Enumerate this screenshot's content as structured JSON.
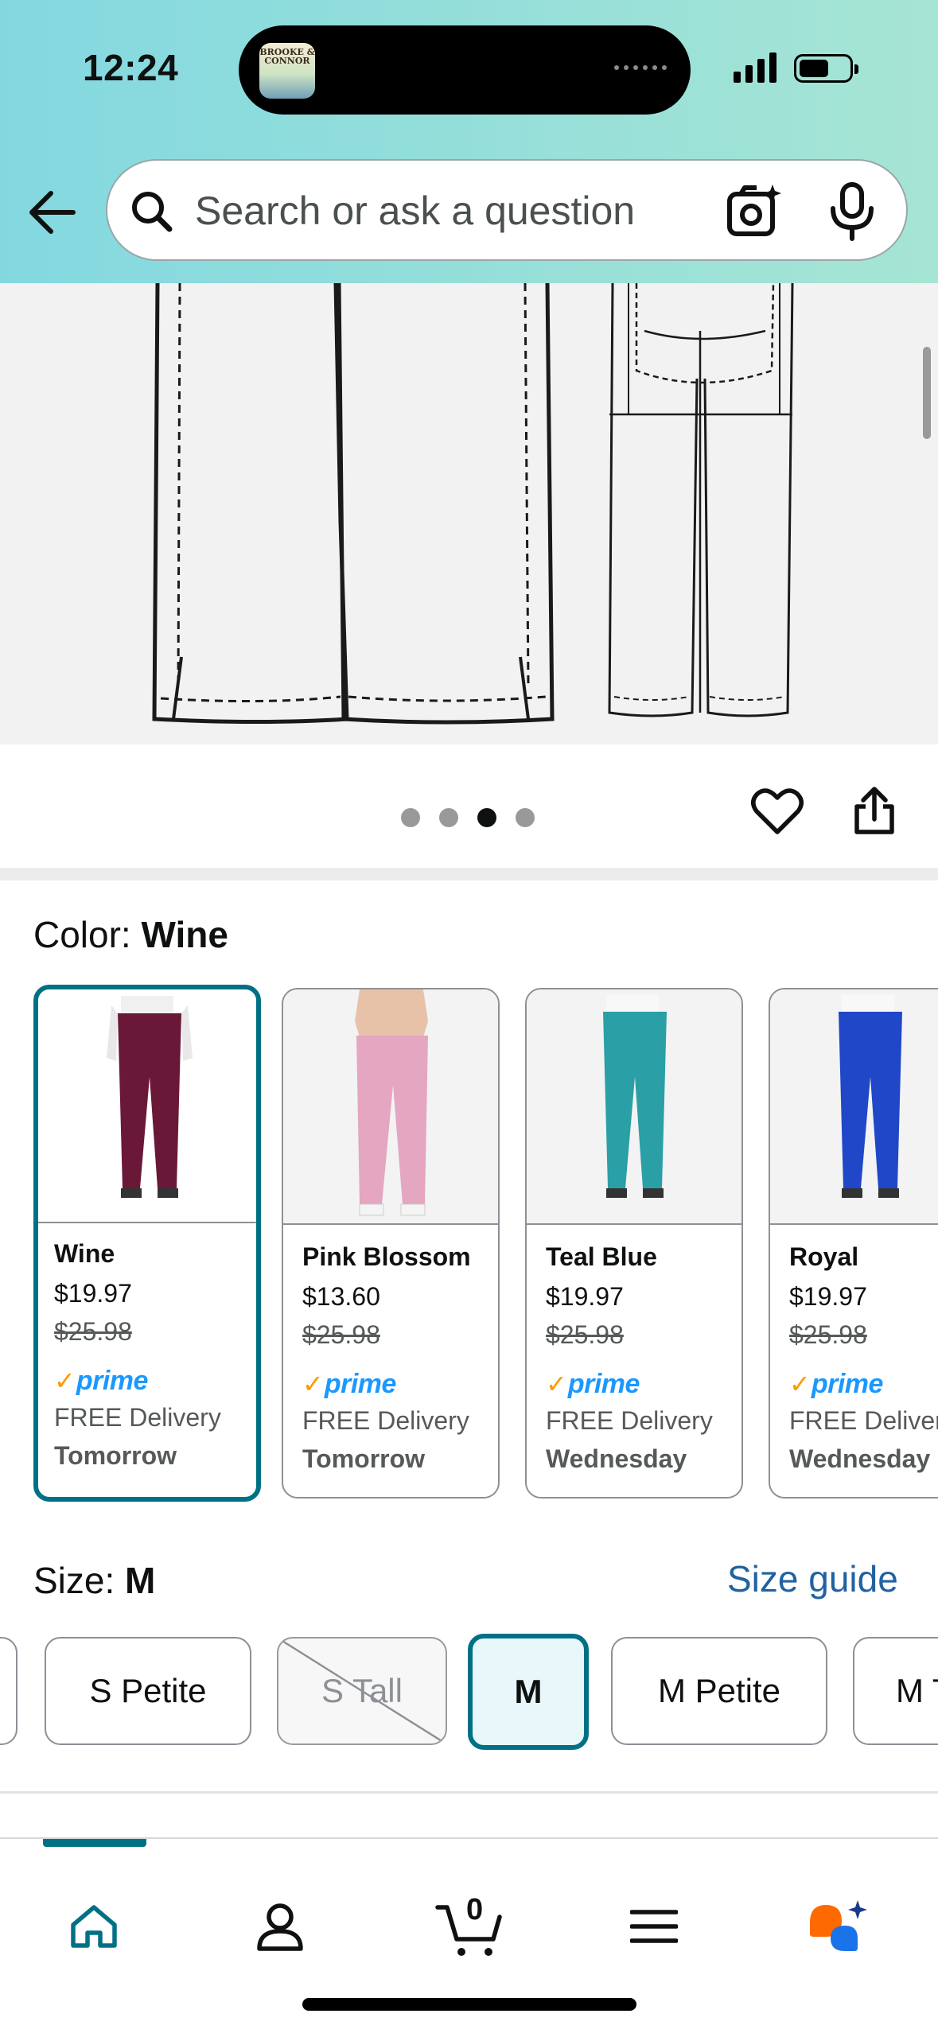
{
  "status_bar": {
    "time": "12:24",
    "island_app_label": "BROOKE & CONNOR"
  },
  "search": {
    "placeholder": "Search or ask a question"
  },
  "icons": {
    "back": "arrow-left-icon",
    "search": "search-icon",
    "camera": "camera-lens-icon",
    "mic": "microphone-icon",
    "favorite": "heart-icon",
    "share": "share-icon"
  },
  "carousel": {
    "total": 4,
    "active_index": 2
  },
  "color": {
    "label": "Color: ",
    "selected": "Wine",
    "options": [
      {
        "name": "Wine",
        "price": "$19.97",
        "list_price": "$25.98",
        "prime": "prime",
        "delivery": "FREE Delivery",
        "day": "Tomorrow",
        "swatch": "#6a1838",
        "selected": true
      },
      {
        "name": "Pink Blossom",
        "price": "$13.60",
        "list_price": "$25.98",
        "prime": "prime",
        "delivery": "FREE Delivery",
        "day": "Tomorrow",
        "swatch": "#e4a6c0",
        "selected": false
      },
      {
        "name": "Teal Blue",
        "price": "$19.97",
        "list_price": "$25.98",
        "prime": "prime",
        "delivery": "FREE Delivery",
        "day": "Wednesday",
        "swatch": "#2a9fa6",
        "selected": false
      },
      {
        "name": "Royal",
        "price": "$19.97",
        "list_price": "$25.98",
        "prime": "prime",
        "delivery": "FREE Delivery",
        "day": "Wednesday",
        "swatch": "#1f47c8",
        "selected": false
      }
    ]
  },
  "size": {
    "label": "Size: ",
    "selected": "M",
    "guide_link": "Size guide",
    "options": [
      {
        "label": "S Petite",
        "available": true,
        "selected": false
      },
      {
        "label": "S Tall",
        "available": false,
        "selected": false
      },
      {
        "label": "M",
        "available": true,
        "selected": true
      },
      {
        "label": "M Petite",
        "available": true,
        "selected": false
      },
      {
        "label": "M T",
        "available": true,
        "selected": false
      }
    ]
  },
  "bottom_nav": {
    "cart_count": "0",
    "items": [
      "home-icon",
      "account-icon",
      "cart-icon",
      "menu-icon",
      "rufus-assistant-icon"
    ],
    "active": "home"
  },
  "colors": {
    "accent": "#007185",
    "link": "#2162a1",
    "prime_check": "#ff9900",
    "prime_text": "#1a98ff"
  }
}
